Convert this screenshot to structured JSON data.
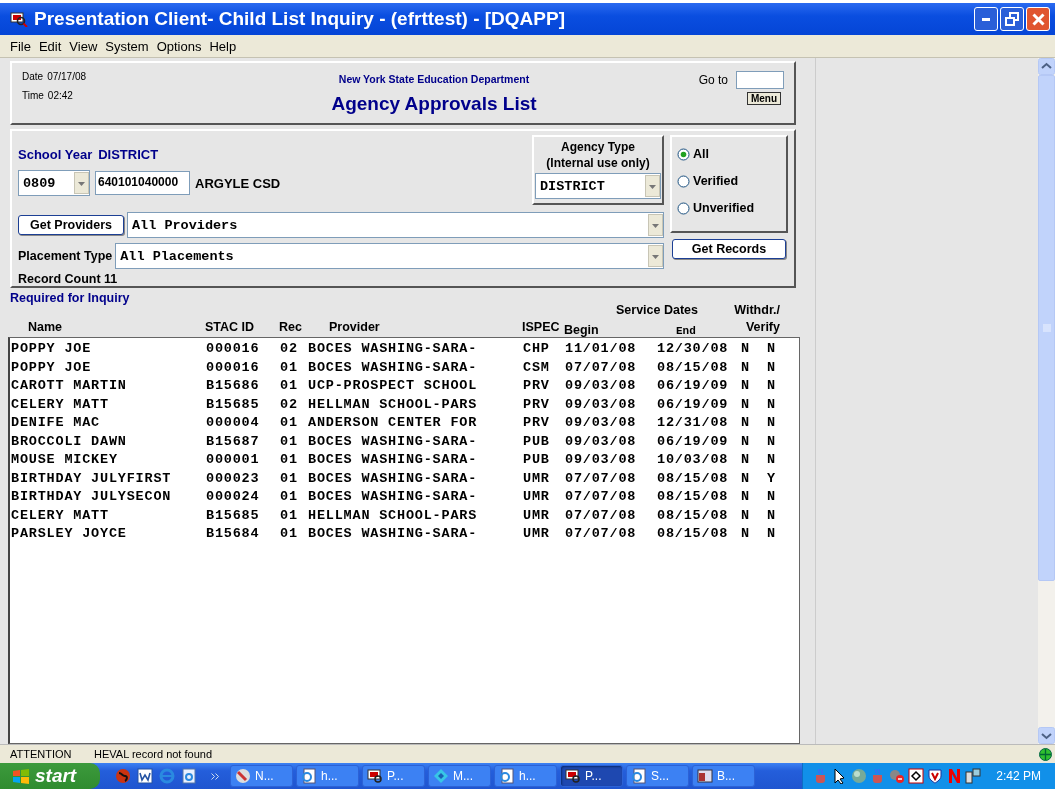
{
  "window": {
    "title": "Presentation Client- Child List Inquiry - (efrttest) - [DQAPP]"
  },
  "menu": [
    "File",
    "Edit",
    "View",
    "System",
    "Options",
    "Help"
  ],
  "header": {
    "date_label": "Date",
    "date": "07/17/08",
    "time_label": "Time",
    "time": "02:42",
    "department": "New York State Education Department",
    "heading": "Agency Approvals List",
    "goto_label": "Go to",
    "menu_button": "Menu"
  },
  "filters": {
    "school_year_label": "School Year",
    "district_label": "DISTRICT",
    "school_year": "0809",
    "district_code": "640101040000",
    "district_name": "ARGYLE CSD",
    "agency_type_label": "Agency Type",
    "agency_type_note": "(Internal use only)",
    "agency_type": "DISTRICT",
    "radios": [
      {
        "label": "All",
        "selected": true
      },
      {
        "label": "Verified",
        "selected": false
      },
      {
        "label": "Unverified",
        "selected": false
      }
    ],
    "get_providers": "Get Providers",
    "providers": "All Providers",
    "placement_label": "Placement Type",
    "placement": "All Placements",
    "get_records": "Get Records",
    "record_count": "Record Count 11"
  },
  "table": {
    "caption": "Required for Inquiry",
    "group_headings": [
      "Service Dates"
    ],
    "columns": [
      "Name",
      "STAC ID",
      "Rec",
      "Provider",
      "ISPEC",
      "Begin",
      "End",
      "Withdr./",
      "Verify"
    ],
    "rows": [
      [
        "POPPY JOE",
        "000016",
        "02",
        "BOCES WASHING-SARA-",
        "CHP",
        "11/01/08",
        "12/30/08",
        "N",
        "N"
      ],
      [
        "POPPY JOE",
        "000016",
        "01",
        "BOCES WASHING-SARA-",
        "CSM",
        "07/07/08",
        "08/15/08",
        "N",
        "N"
      ],
      [
        "CAROTT MARTIN",
        "B15686",
        "01",
        "UCP-PROSPECT SCHOOL",
        "PRV",
        "09/03/08",
        "06/19/09",
        "N",
        "N"
      ],
      [
        "CELERY MATT",
        "B15685",
        "02",
        "HELLMAN SCHOOL-PARS",
        "PRV",
        "09/03/08",
        "06/19/09",
        "N",
        "N"
      ],
      [
        "DENIFE MAC",
        "000004",
        "01",
        "ANDERSON CENTER FOR",
        "PRV",
        "09/03/08",
        "12/31/08",
        "N",
        "N"
      ],
      [
        "BROCCOLI DAWN",
        "B15687",
        "01",
        "BOCES WASHING-SARA-",
        "PUB",
        "09/03/08",
        "06/19/09",
        "N",
        "N"
      ],
      [
        "MOUSE MICKEY",
        "000001",
        "01",
        "BOCES WASHING-SARA-",
        "PUB",
        "09/03/08",
        "10/03/08",
        "N",
        "N"
      ],
      [
        "BIRTHDAY JULYFIRST",
        "000023",
        "01",
        "BOCES WASHING-SARA-",
        "UMR",
        "07/07/08",
        "08/15/08",
        "N",
        "Y"
      ],
      [
        "BIRTHDAY JULYSECON",
        "000024",
        "01",
        "BOCES WASHING-SARA-",
        "UMR",
        "07/07/08",
        "08/15/08",
        "N",
        "N"
      ],
      [
        "CELERY MATT",
        "B15685",
        "01",
        "HELLMAN SCHOOL-PARS",
        "UMR",
        "07/07/08",
        "08/15/08",
        "N",
        "N"
      ],
      [
        "PARSLEY JOYCE",
        "B15684",
        "01",
        "BOCES WASHING-SARA-",
        "UMR",
        "07/07/08",
        "08/15/08",
        "N",
        "N"
      ]
    ]
  },
  "status_bar": {
    "label": "ATTENTION",
    "message": "HEVAL record not found"
  },
  "taskbar": {
    "start": "start",
    "buttons": [
      {
        "label": "N...",
        "selected": false
      },
      {
        "label": "h...",
        "selected": false
      },
      {
        "label": "P...",
        "selected": false
      },
      {
        "label": "M...",
        "selected": false
      },
      {
        "label": "h...",
        "selected": false
      },
      {
        "label": "P...",
        "selected": true
      },
      {
        "label": "S...",
        "selected": false
      },
      {
        "label": "B...",
        "selected": false
      }
    ],
    "clock": "2:42 PM"
  }
}
